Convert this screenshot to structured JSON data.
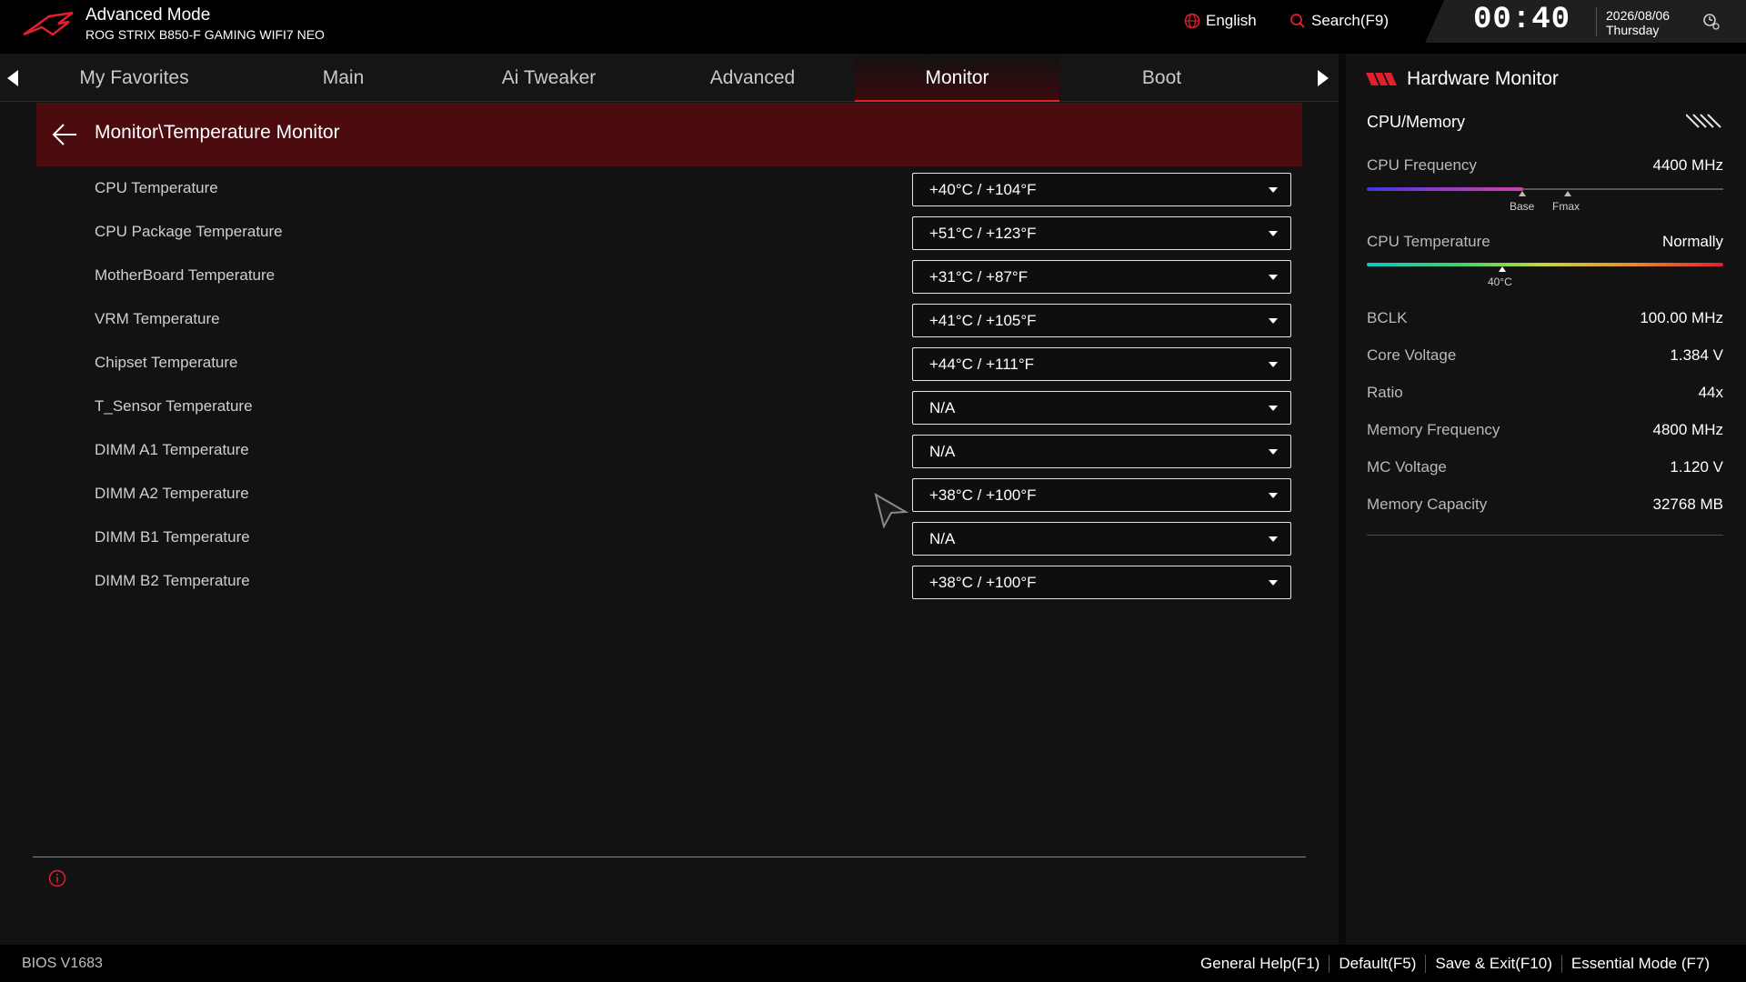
{
  "header": {
    "mode_title": "Advanced Mode",
    "board_name": "ROG STRIX B850-F GAMING WIFI7 NEO",
    "language": "English",
    "search": "Search(F9)",
    "time": "00:40",
    "date": "2026/08/06",
    "weekday": "Thursday"
  },
  "tabs": [
    {
      "label": "My Favorites",
      "active": false
    },
    {
      "label": "Main",
      "active": false
    },
    {
      "label": "Ai Tweaker",
      "active": false
    },
    {
      "label": "Advanced",
      "active": false
    },
    {
      "label": "Monitor",
      "active": true
    },
    {
      "label": "Boot",
      "active": false
    }
  ],
  "breadcrumb": "Monitor\\Temperature Monitor",
  "settings": [
    {
      "label": "CPU Temperature",
      "value": "+40°C / +104°F"
    },
    {
      "label": "CPU Package Temperature",
      "value": "+51°C / +123°F"
    },
    {
      "label": "MotherBoard Temperature",
      "value": "+31°C / +87°F"
    },
    {
      "label": "VRM Temperature",
      "value": "+41°C / +105°F"
    },
    {
      "label": "Chipset Temperature",
      "value": "+44°C / +111°F"
    },
    {
      "label": "T_Sensor Temperature",
      "value": "N/A"
    },
    {
      "label": "DIMM A1 Temperature",
      "value": "N/A"
    },
    {
      "label": "DIMM A2 Temperature",
      "value": "+38°C / +100°F"
    },
    {
      "label": "DIMM B1 Temperature",
      "value": "N/A"
    },
    {
      "label": "DIMM B2 Temperature",
      "value": "+38°C / +100°F"
    }
  ],
  "hardware_monitor": {
    "title": "Hardware Monitor",
    "section": "CPU/Memory",
    "cpu_frequency": {
      "label": "CPU Frequency",
      "value": "4400 MHz",
      "base_label": "Base",
      "fmax_label": "Fmax",
      "fill_fraction": 0.44
    },
    "cpu_temperature": {
      "label": "CPU Temperature",
      "status": "Normally",
      "marker_label": "40°C",
      "marker_fraction": 0.38
    },
    "rows": [
      {
        "label": "BCLK",
        "value": "100.00 MHz"
      },
      {
        "label": "Core Voltage",
        "value": "1.384 V"
      },
      {
        "label": "Ratio",
        "value": "44x"
      },
      {
        "label": "Memory Frequency",
        "value": "4800 MHz"
      },
      {
        "label": "MC Voltage",
        "value": "1.120 V"
      },
      {
        "label": "Memory Capacity",
        "value": "32768 MB"
      }
    ]
  },
  "footer": {
    "bios_version": "BIOS V1683",
    "items": [
      "General Help(F1)",
      "Default(F5)",
      "Save & Exit(F10)",
      "Essential Mode (F7)"
    ]
  },
  "colors": {
    "accent": "#e0202a",
    "breadcrumb_bg": "#4b0b0f"
  }
}
